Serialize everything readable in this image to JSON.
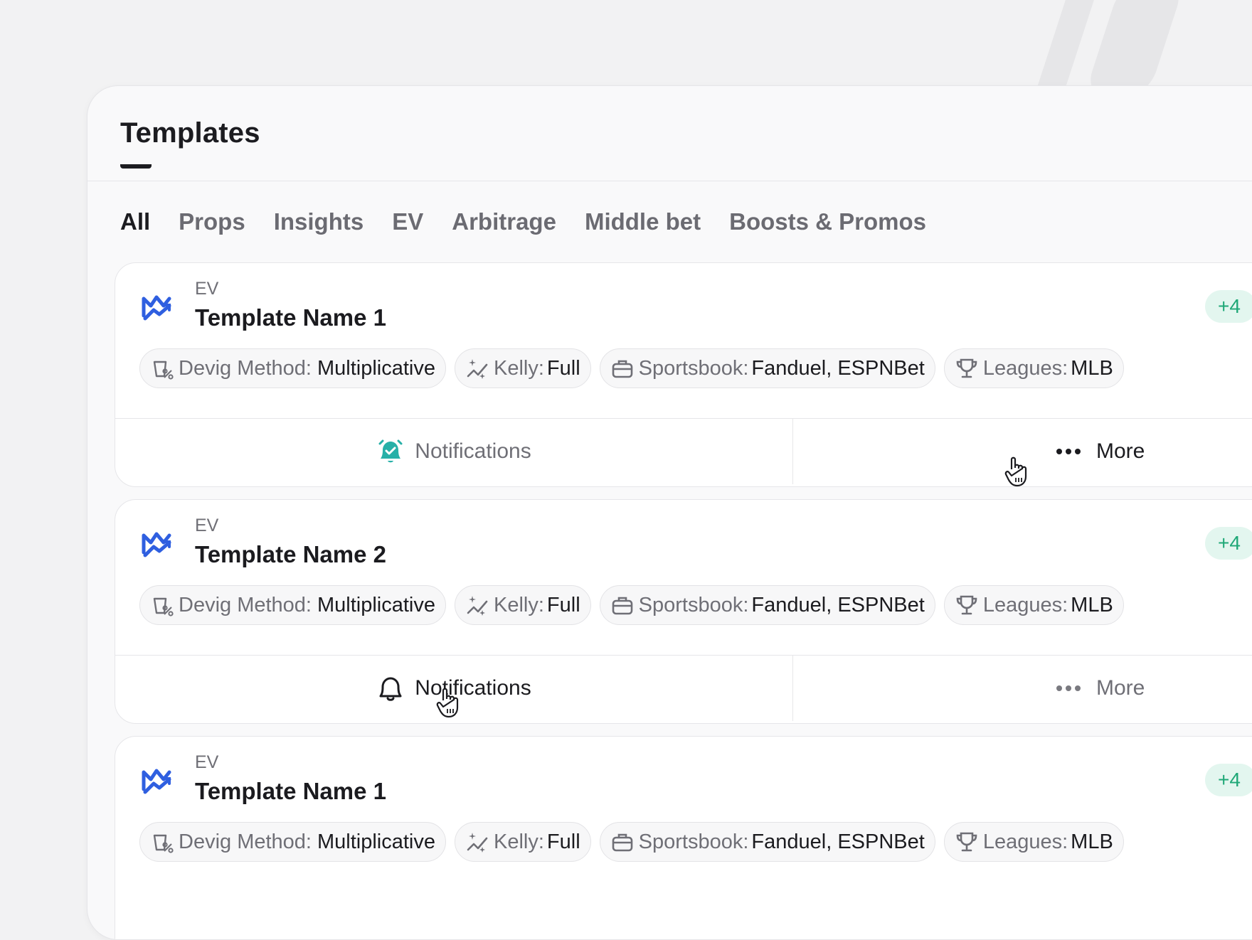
{
  "header": {
    "title": "Templates"
  },
  "tabs": [
    {
      "label": "All"
    },
    {
      "label": "Props"
    },
    {
      "label": "Insights"
    },
    {
      "label": "EV"
    },
    {
      "label": "Arbitrage"
    },
    {
      "label": "Middle bet"
    },
    {
      "label": "Boosts & Promos"
    }
  ],
  "active_tab": "All",
  "colors": {
    "accent_blue": "#2f5fe0",
    "teal": "#27b0a8",
    "badge_green": "#1fa877"
  },
  "cards": [
    {
      "category": "EV",
      "name": "Template Name 1",
      "badge": "+4",
      "chips": [
        {
          "key": "Devig Method:",
          "value": "Multiplicative",
          "icon": "devig-percent-icon"
        },
        {
          "key": "Kelly:",
          "value": "Full",
          "icon": "sparkle-trend-icon"
        },
        {
          "key": "Sportsbook:",
          "value": "Fanduel, ESPNBet",
          "icon": "briefcase-icon"
        },
        {
          "key": "Leagues:",
          "value": "MLB",
          "icon": "trophy-icon"
        }
      ],
      "notifications_label": "Notifications",
      "more_label": "More",
      "notifications_on": true
    },
    {
      "category": "EV",
      "name": "Template Name 2",
      "badge": "+4",
      "chips": [
        {
          "key": "Devig Method:",
          "value": "Multiplicative",
          "icon": "devig-percent-icon"
        },
        {
          "key": "Kelly:",
          "value": "Full",
          "icon": "sparkle-trend-icon"
        },
        {
          "key": "Sportsbook:",
          "value": "Fanduel, ESPNBet",
          "icon": "briefcase-icon"
        },
        {
          "key": "Leagues:",
          "value": "MLB",
          "icon": "trophy-icon"
        }
      ],
      "notifications_label": "Notifications",
      "more_label": "More",
      "notifications_on": false
    },
    {
      "category": "EV",
      "name": "Template Name 1",
      "badge": "+4",
      "chips": [
        {
          "key": "Devig Method:",
          "value": "Multiplicative",
          "icon": "devig-percent-icon"
        },
        {
          "key": "Kelly:",
          "value": "Full",
          "icon": "sparkle-trend-icon"
        },
        {
          "key": "Sportsbook:",
          "value": "Fanduel, ESPNBet",
          "icon": "briefcase-icon"
        },
        {
          "key": "Leagues:",
          "value": "MLB",
          "icon": "trophy-icon"
        }
      ]
    }
  ]
}
